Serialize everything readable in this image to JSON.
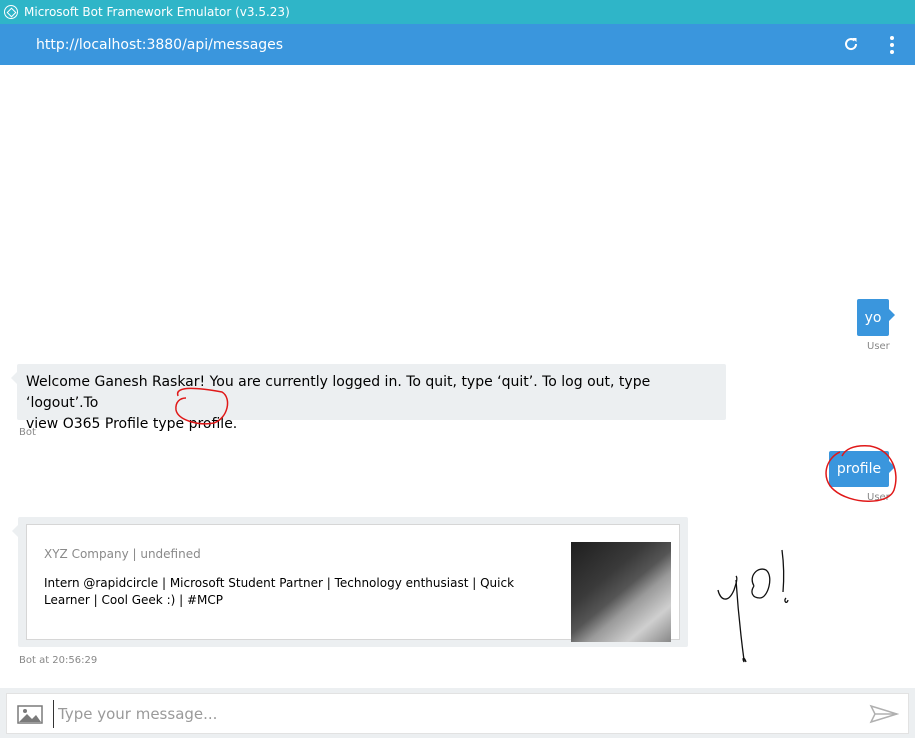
{
  "window": {
    "title": "Microsoft Bot Framework Emulator (v3.5.23)"
  },
  "address": {
    "url": "http://localhost:3880/api/messages",
    "refresh_icon": "refresh-icon",
    "menu_icon": "kebab-menu-icon"
  },
  "messages": [
    {
      "from": "user",
      "text": "yo",
      "meta": "User"
    },
    {
      "from": "bot",
      "text_line1": "Welcome Ganesh Raskar! You are currently logged in. To quit, type ‘quit’. To log out, type ‘logout’.To",
      "text_line2": "view O365 Profile type profile.",
      "meta": "Bot"
    },
    {
      "from": "user",
      "text": "profile",
      "meta": "User"
    }
  ],
  "card": {
    "subtitle": "XYZ Company | undefined",
    "text": "Intern @rapidcircle | Microsoft Student Partner | Technology enthusiast | Quick Learner | Cool Geek :) | #MCP",
    "meta": "Bot at 20:56:29"
  },
  "annotation": {
    "handwriting": "yo!",
    "color": "#e01818"
  },
  "composer": {
    "placeholder": "Type your message...",
    "value": "",
    "image_icon": "image-icon",
    "send_icon": "send-icon"
  },
  "colors": {
    "titlebar": "#2fb5c8",
    "accent": "#3a96dd",
    "bot_bubble": "#eceff1"
  }
}
